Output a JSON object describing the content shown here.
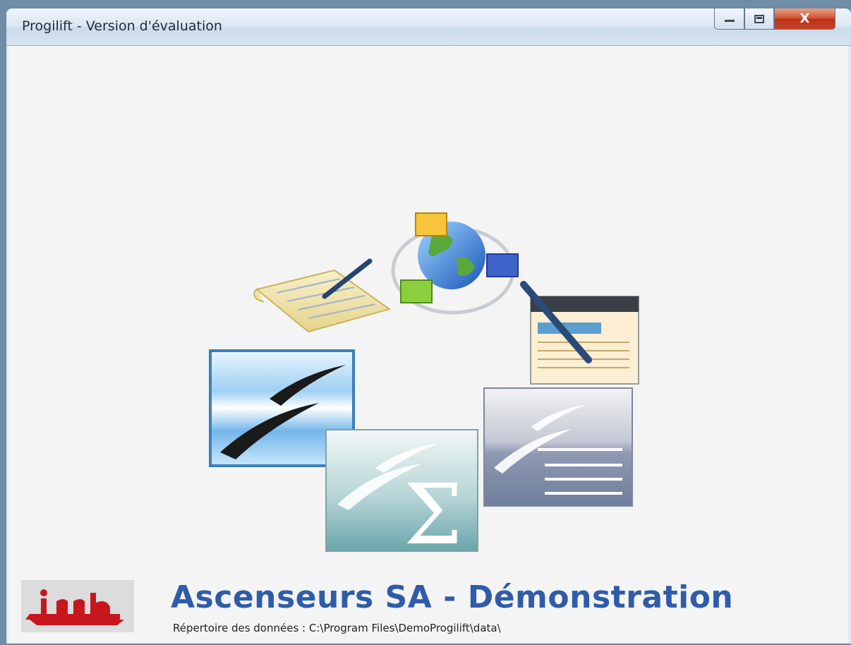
{
  "window": {
    "title": "Progilift - Version d'évaluation",
    "controls": {
      "minimize": "minimize-icon",
      "maximize": "maximize-icon",
      "close": "close-icon",
      "close_label": "X"
    }
  },
  "splash": {
    "company": "Ascenseurs SA - Démonstration",
    "data_directory": "Répertoire des données : C:\\Program Files\\DemoProgilift\\data\\",
    "logo_text": "jmb",
    "icons": [
      "notepad-pen-icon",
      "globe-network-icon",
      "web-page-edit-icon",
      "openoffice-icon",
      "calc-spreadsheet-icon",
      "writer-document-icon"
    ]
  },
  "colors": {
    "brand_text": "#2f5ca9",
    "logo_red": "#c8161d",
    "client_bg": "#f4f4f4"
  }
}
